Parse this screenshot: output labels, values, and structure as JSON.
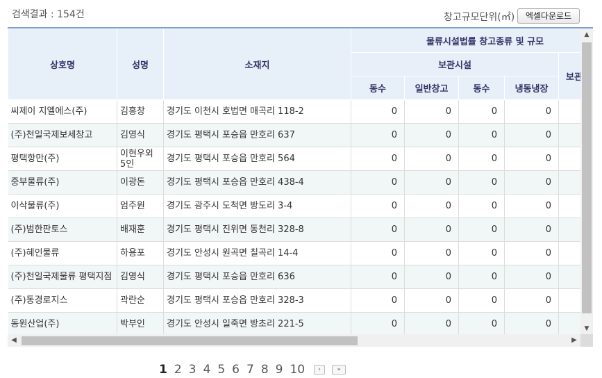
{
  "summary": {
    "result_text": "검색결과 : 154건",
    "unit_text": "창고규모단위(㎡)",
    "excel_button": "엑셀다운로드"
  },
  "table": {
    "headers": {
      "company": "상호명",
      "name": "성명",
      "address": "소재지",
      "group_top": "물류시설법률 창고종류 및 규모",
      "group_storage": "보관시설",
      "group_storage2": "보관",
      "cols": [
        "동수",
        "일반창고",
        "동수",
        "냉동냉장"
      ]
    },
    "rows": [
      {
        "company": "씨제이 지엘에스(주)",
        "name": "김홍창",
        "address": "경기도 이천시 호법면 매곡리 118-2",
        "v": [
          "0",
          "0",
          "0",
          "0"
        ]
      },
      {
        "company": "(주)천일국제보세창고",
        "name": "김영식",
        "address": "경기도 평택시 포승읍 만호리 637",
        "v": [
          "0",
          "0",
          "0",
          "0"
        ]
      },
      {
        "company": "평택항만(주)",
        "name": "이현우외 5인",
        "address": "경기도 평택시 포승읍 만호리 564",
        "v": [
          "0",
          "0",
          "0",
          "0"
        ]
      },
      {
        "company": "중부물류(주)",
        "name": "이광돈",
        "address": "경기도 평택시 포승읍 만호리 438-4",
        "v": [
          "0",
          "0",
          "0",
          "0"
        ]
      },
      {
        "company": "이삭물류(주)",
        "name": "엄주원",
        "address": "경기도 광주시 도척면 방도리 3-4",
        "v": [
          "0",
          "0",
          "0",
          "0"
        ]
      },
      {
        "company": "(주)범한판토스",
        "name": "배재훈",
        "address": "경기도 평택시 진위면 동천리 328-8",
        "v": [
          "0",
          "0",
          "0",
          "0"
        ]
      },
      {
        "company": "(주)혜인물류",
        "name": "하용포",
        "address": "경기도 안성시 원곡면 칠곡리 14-4",
        "v": [
          "0",
          "0",
          "0",
          "0"
        ]
      },
      {
        "company": "(주)천일국제물류 평택지점",
        "name": "김영식",
        "address": "경기도 평택시 포승읍 만호리 636",
        "v": [
          "0",
          "0",
          "0",
          "0"
        ]
      },
      {
        "company": "(주)동경로지스",
        "name": "곽란순",
        "address": "경기도 평택시 포승읍 만호리 328-3",
        "v": [
          "0",
          "0",
          "0",
          "0"
        ]
      },
      {
        "company": "동원산업(주)",
        "name": "박부인",
        "address": "경기도 안성시 일죽면 방초리 221-5",
        "v": [
          "0",
          "0",
          "0",
          "0"
        ]
      }
    ]
  },
  "pagination": {
    "pages": [
      "1",
      "2",
      "3",
      "4",
      "5",
      "6",
      "7",
      "8",
      "9",
      "10"
    ],
    "current": "1",
    "next_icon": "chevron-right-icon",
    "last_icon": "double-chevron-right-icon"
  },
  "scrollbars": {
    "up_icon": "arrow-up-icon",
    "down_icon": "arrow-down-icon",
    "left_icon": "arrow-left-icon",
    "right_icon": "arrow-right-icon"
  },
  "colors": {
    "header_bg": "#e7eff9",
    "header_text": "#336",
    "row_alt": "#f1f6f6",
    "top_border": "#7a9fd0"
  }
}
